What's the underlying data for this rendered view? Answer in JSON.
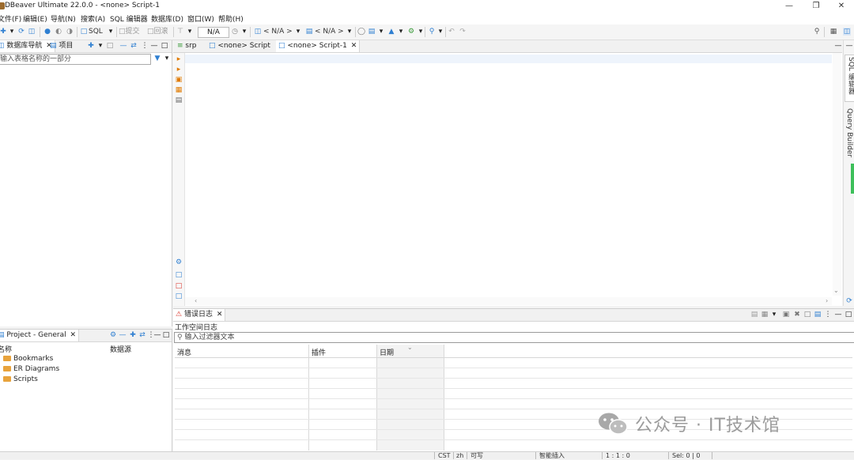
{
  "window": {
    "title": "DBeaver Ultimate 22.0.0 - <none> Script-1"
  },
  "menu": [
    "文件(F)",
    "编辑(E)",
    "导航(N)",
    "搜索(A)",
    "SQL 编辑器",
    "数据库(D)",
    "窗口(W)",
    "帮助(H)"
  ],
  "toolbar": {
    "sql_label": "SQL",
    "commit_label": "提交",
    "rollback_label": "回滚",
    "transaction_mode": "N/A",
    "datasource_combo": "< N/A >",
    "schema_combo": "< N/A >"
  },
  "left_panel": {
    "tab_db_nav": "数据库导航",
    "tab_projects": "项目",
    "filter_placeholder": "输入表格名称的一部分"
  },
  "editor": {
    "tabs": [
      "srp",
      "<none> Script",
      "<none> Script-1"
    ],
    "side_tab_sql": "SQL 编辑器",
    "side_tab_qb": "Query Builder"
  },
  "project_panel": {
    "tab": "Project - General",
    "col_name": "名称",
    "col_datasource": "数据源",
    "items": [
      "Bookmarks",
      "ER Diagrams",
      "Scripts"
    ]
  },
  "error_log": {
    "tab": "错误日志",
    "subtitle": "工作空间日志",
    "filter_placeholder": "输入过滤器文本",
    "columns": [
      "消息",
      "插件",
      "日期"
    ]
  },
  "status": {
    "tz": "CST",
    "lang": "zh",
    "mode": "可写",
    "insert": "智能插入",
    "pos": "1 : 1 : 0",
    "sel": "Sel: 0 | 0"
  },
  "watermark": {
    "text": "公众号 · IT技术馆"
  },
  "colors": {
    "accent": "#2f7fd1",
    "folder": "#e8a33c",
    "error": "#d9342b"
  }
}
